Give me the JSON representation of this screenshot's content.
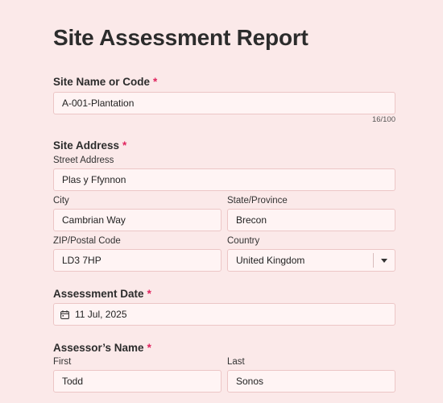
{
  "form": {
    "title": "Site Assessment Report",
    "required_mark": "*",
    "site_name": {
      "label": "Site Name or Code",
      "value": "A-001-Plantation",
      "counter": "16/100"
    },
    "site_address": {
      "label": "Site Address",
      "street_label": "Street Address",
      "street_value": "Plas y Ffynnon",
      "city_label": "City",
      "city_value": "Cambrian Way",
      "state_label": "State/Province",
      "state_value": "Brecon",
      "zip_label": "ZIP/Postal Code",
      "zip_value": "LD3 7HP",
      "country_label": "Country",
      "country_value": "United Kingdom"
    },
    "assessment_date": {
      "label": "Assessment Date",
      "value": "11 Jul, 2025",
      "icon": "calendar-icon"
    },
    "assessor_name": {
      "label": "Assessor’s Name",
      "first_label": "First",
      "first_value": "Todd",
      "last_label": "Last",
      "last_value": "Sonos"
    }
  },
  "colors": {
    "background": "#fbe9e9",
    "input_background": "#fff4f4",
    "input_border": "#ecc6c6",
    "required": "#e0245e"
  }
}
